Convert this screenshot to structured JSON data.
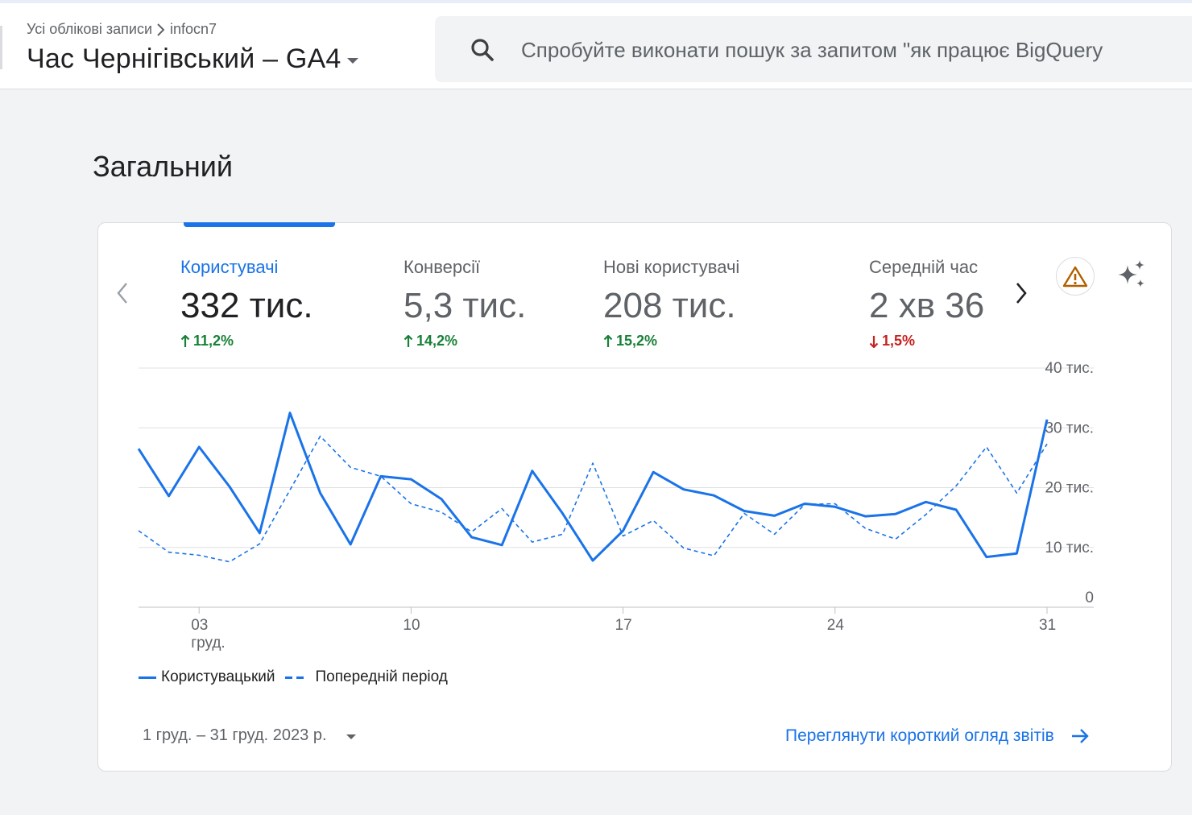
{
  "header": {
    "breadcrumb": {
      "root": "Усі облікові записи",
      "account": "infocn7"
    },
    "property_title": "Час Чернігівський – GA4",
    "search_placeholder": "Спробуйте виконати пошук за запитом \"як працює BigQuery"
  },
  "section_title": "Загальний",
  "metrics": [
    {
      "label": "Користувачі",
      "value": "332 тис.",
      "delta": "11,2%",
      "direction": "up"
    },
    {
      "label": "Конверсії",
      "value": "5,3 тис.",
      "delta": "14,2%",
      "direction": "up"
    },
    {
      "label": "Нові користувачі",
      "value": "208 тис.",
      "delta": "15,2%",
      "direction": "up"
    },
    {
      "label": "Середній час",
      "value": "2 хв 36",
      "delta": "1,5%",
      "direction": "down"
    }
  ],
  "icons": {
    "prev": "chevron-left-icon",
    "next": "chevron-right-icon",
    "alert": "warning-icon",
    "insights": "sparkle-icon",
    "search": "search-icon",
    "link_arrow": "arrow-right-icon"
  },
  "colors": {
    "accent": "#1a73e8",
    "positive": "#188038",
    "negative": "#c5221f",
    "warning": "#b06000"
  },
  "chart_data": {
    "type": "line",
    "x": [
      1,
      2,
      3,
      4,
      5,
      6,
      7,
      8,
      9,
      10,
      11,
      12,
      13,
      14,
      15,
      16,
      17,
      18,
      19,
      20,
      21,
      22,
      23,
      24,
      25,
      26,
      27,
      28,
      29,
      30,
      31
    ],
    "x_tick_values": [
      3,
      10,
      17,
      24,
      31
    ],
    "x_tick_labels": [
      "03",
      "10",
      "17",
      "24",
      "31"
    ],
    "x_tick_sublabel": "груд.",
    "y_ticks": [
      0,
      10000,
      20000,
      30000,
      40000
    ],
    "y_tick_labels": [
      "0",
      "10 тис.",
      "20 тис.",
      "30 тис.",
      "40 тис."
    ],
    "ylim": [
      0,
      40000
    ],
    "grid": true,
    "legend_position": "bottom-left",
    "series": [
      {
        "name": "Користувацький",
        "style": "solid",
        "values": [
          26500,
          18600,
          26800,
          20200,
          12400,
          32500,
          19100,
          10500,
          21900,
          21400,
          18100,
          11700,
          10400,
          22800,
          15700,
          7800,
          12800,
          22600,
          19700,
          18700,
          16100,
          15300,
          17300,
          16800,
          15200,
          15600,
          17600,
          16300,
          8400,
          9000,
          31400
        ]
      },
      {
        "name": "Попередній період",
        "style": "dashed",
        "values": [
          12800,
          9200,
          8700,
          7600,
          10600,
          19600,
          28600,
          23400,
          21900,
          17300,
          15900,
          12600,
          16500,
          10900,
          12200,
          24100,
          11900,
          14500,
          9900,
          8600,
          15700,
          12200,
          17200,
          17300,
          13200,
          11400,
          15500,
          20300,
          26800,
          19100,
          27300
        ]
      }
    ]
  },
  "footer": {
    "date_range": "1 груд. – 31 груд. 2023 р.",
    "view_link": "Переглянути короткий огляд звітів"
  }
}
